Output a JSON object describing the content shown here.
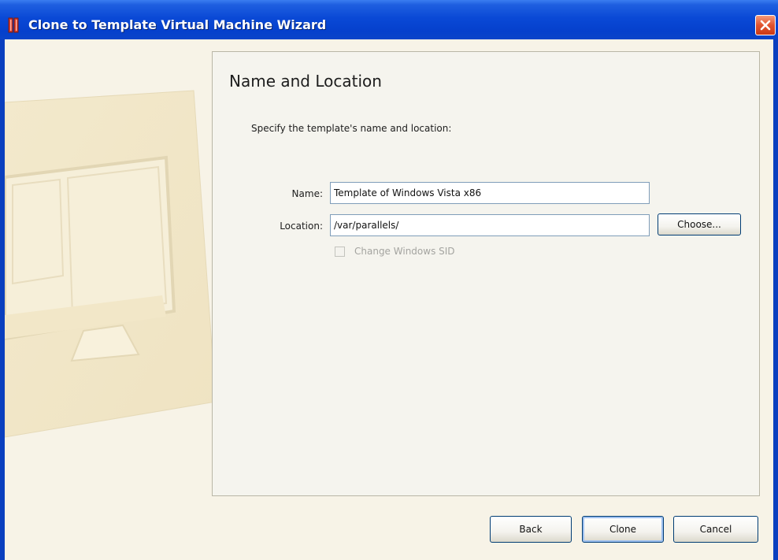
{
  "window": {
    "title": "Clone to Template Virtual Machine Wizard",
    "title_icon": "parallels-icon",
    "close_icon": "close-icon",
    "colors": {
      "titlebar": "#0a49d6",
      "close": "#e1532f",
      "client": "#f7f3e7"
    }
  },
  "page": {
    "heading": "Name and Location",
    "subtitle": "Specify the template's name and location:"
  },
  "form": {
    "name_label": "Name:",
    "name_value": "Template of Windows Vista x86",
    "location_label": "Location:",
    "location_value": "/var/parallels/",
    "choose_label": "Choose...",
    "sid_checkbox_label": "Change Windows SID",
    "sid_checked": false,
    "sid_enabled": false
  },
  "buttons": {
    "back": "Back",
    "clone": "Clone",
    "cancel": "Cancel"
  }
}
